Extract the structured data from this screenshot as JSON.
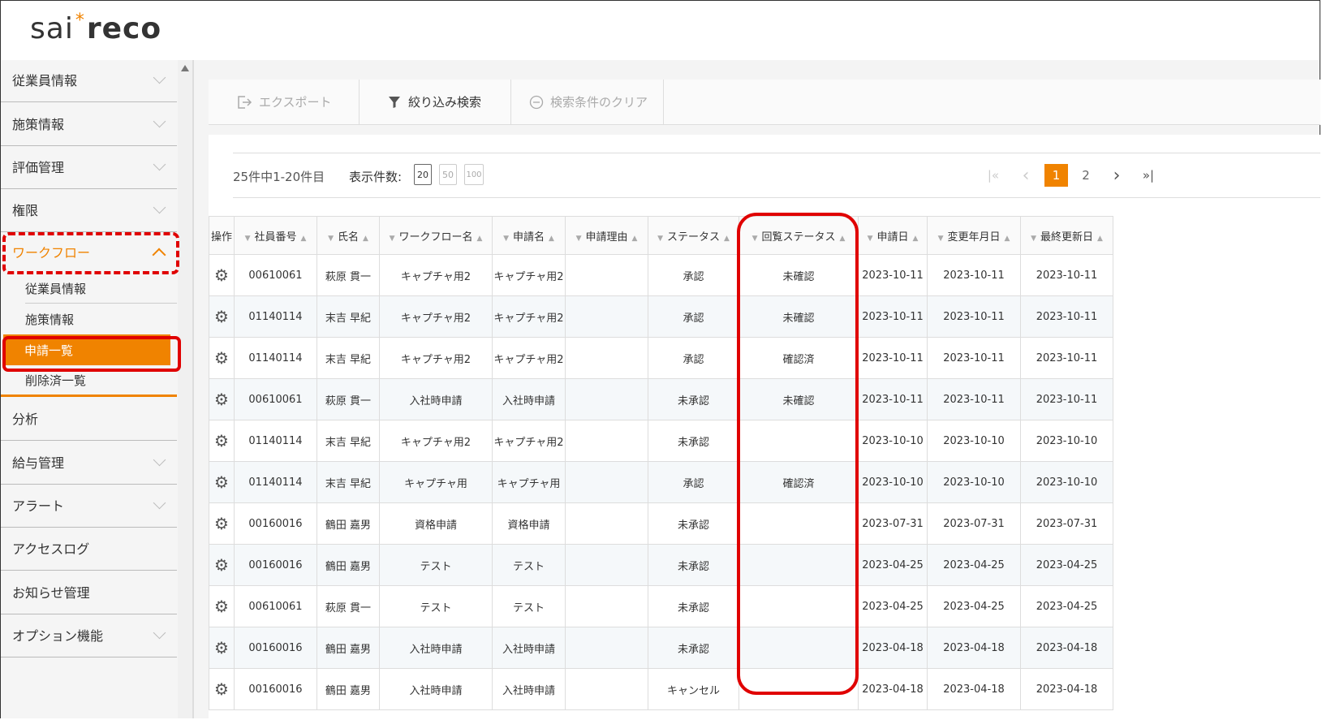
{
  "logo": {
    "part1": "sai",
    "star": "*",
    "part2": "reco"
  },
  "sidebar": {
    "items": [
      {
        "label": "従業員情報"
      },
      {
        "label": "施策情報"
      },
      {
        "label": "評価管理"
      },
      {
        "label": "権限"
      },
      {
        "label": "ワークフロー"
      },
      {
        "label": "分析"
      },
      {
        "label": "給与管理"
      },
      {
        "label": "アラート"
      },
      {
        "label": "アクセスログ"
      },
      {
        "label": "お知らせ管理"
      },
      {
        "label": "オプション機能"
      }
    ],
    "workflow_sub": [
      {
        "label": "従業員情報"
      },
      {
        "label": "施策情報"
      },
      {
        "label": "申請一覧"
      },
      {
        "label": "削除済一覧"
      }
    ]
  },
  "toolbar": {
    "export_label": "エクスポート",
    "filter_label": "絞り込み検索",
    "clear_label": "検索条件のクリア"
  },
  "pager": {
    "count_text": "25件中1-20件目",
    "per_page_label": "表示件数:",
    "per_page_options": [
      "20",
      "50",
      "100"
    ],
    "pages": [
      "1",
      "2"
    ],
    "first": "|«",
    "prev": "‹",
    "next": "›",
    "last": "»|"
  },
  "table": {
    "headers": [
      "操作",
      "社員番号",
      "氏名",
      "ワークフロー名",
      "申請名",
      "申請理由",
      "ステータス",
      "回覧ステータス",
      "申請日",
      "変更年月日",
      "最終更新日"
    ],
    "rows": [
      [
        "00610061",
        "萩原 貫一",
        "キャプチャ用2",
        "キャプチャ用2",
        "",
        "承認",
        "未確認",
        "2023-10-11",
        "2023-10-11",
        "2023-10-11"
      ],
      [
        "01140114",
        "末吉 早紀",
        "キャプチャ用2",
        "キャプチャ用2",
        "",
        "承認",
        "未確認",
        "2023-10-11",
        "2023-10-11",
        "2023-10-11"
      ],
      [
        "01140114",
        "末吉 早紀",
        "キャプチャ用2",
        "キャプチャ用2",
        "",
        "承認",
        "確認済",
        "2023-10-11",
        "2023-10-11",
        "2023-10-11"
      ],
      [
        "00610061",
        "萩原 貫一",
        "入社時申請",
        "入社時申請",
        "",
        "未承認",
        "未確認",
        "2023-10-11",
        "2023-10-11",
        "2023-10-11"
      ],
      [
        "01140114",
        "末吉 早紀",
        "キャプチャ用2",
        "キャプチャ用2",
        "",
        "未承認",
        "",
        "2023-10-10",
        "2023-10-10",
        "2023-10-10"
      ],
      [
        "01140114",
        "末吉 早紀",
        "キャプチャ用",
        "キャプチャ用",
        "",
        "承認",
        "確認済",
        "2023-10-10",
        "2023-10-10",
        "2023-10-10"
      ],
      [
        "00160016",
        "鶴田 嘉男",
        "資格申請",
        "資格申請",
        "",
        "未承認",
        "",
        "2023-07-31",
        "2023-07-31",
        "2023-07-31"
      ],
      [
        "00160016",
        "鶴田 嘉男",
        "テスト",
        "テスト",
        "",
        "未承認",
        "",
        "2023-04-25",
        "2023-04-25",
        "2023-04-25"
      ],
      [
        "00610061",
        "萩原 貫一",
        "テスト",
        "テスト",
        "",
        "未承認",
        "",
        "2023-04-25",
        "2023-04-25",
        "2023-04-25"
      ],
      [
        "00160016",
        "鶴田 嘉男",
        "入社時申請",
        "入社時申請",
        "",
        "未承認",
        "",
        "2023-04-18",
        "2023-04-18",
        "2023-04-18"
      ],
      [
        "00160016",
        "鶴田 嘉男",
        "入社時申請",
        "入社時申請",
        "",
        "キャンセル",
        "",
        "2023-04-18",
        "2023-04-18",
        "2023-04-18"
      ]
    ]
  },
  "colors": {
    "accent": "#f08300",
    "annotation": "#e00000"
  }
}
